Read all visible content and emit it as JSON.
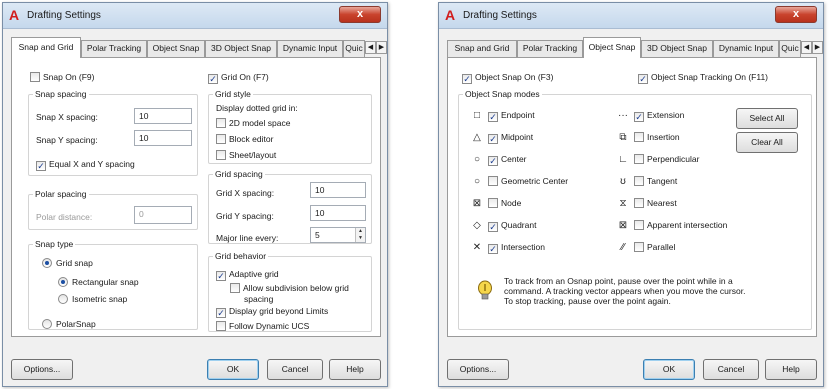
{
  "dialog1": {
    "title": "Drafting Settings",
    "close_label": "x",
    "tabs": [
      "Snap and Grid",
      "Polar Tracking",
      "Object Snap",
      "3D Object Snap",
      "Dynamic Input",
      "Quic"
    ],
    "snap_on": {
      "label": "Snap On (F9)",
      "checked": false
    },
    "grid_on": {
      "label": "Grid On (F7)",
      "checked": true
    },
    "snap_spacing": {
      "title": "Snap spacing",
      "x_label": "Snap X spacing:",
      "x_value": "10",
      "y_label": "Snap Y spacing:",
      "y_value": "10",
      "equal": {
        "label": "Equal X and Y spacing",
        "checked": true
      }
    },
    "polar_spacing": {
      "title": "Polar spacing",
      "label": "Polar distance:",
      "value": "0"
    },
    "snap_type": {
      "title": "Snap type",
      "grid_snap": "Grid snap",
      "rectangular": "Rectangular snap",
      "isometric": "Isometric snap",
      "polar": "PolarSnap"
    },
    "grid_style": {
      "title": "Grid style",
      "subtitle": "Display dotted grid in:",
      "items": [
        {
          "label": "2D model space",
          "checked": false
        },
        {
          "label": "Block editor",
          "checked": false
        },
        {
          "label": "Sheet/layout",
          "checked": false
        }
      ]
    },
    "grid_spacing": {
      "title": "Grid spacing",
      "x_label": "Grid X spacing:",
      "x_value": "10",
      "y_label": "Grid Y spacing:",
      "y_value": "10",
      "major_label": "Major line every:",
      "major_value": "5"
    },
    "grid_behavior": {
      "title": "Grid behavior",
      "adaptive": {
        "label": "Adaptive grid",
        "checked": true
      },
      "subdivision": {
        "label": "Allow subdivision below grid",
        "label2": "spacing",
        "checked": false
      },
      "beyond": {
        "label": "Display grid beyond Limits",
        "checked": true
      },
      "follow": {
        "label": "Follow Dynamic UCS",
        "checked": false
      }
    },
    "buttons": {
      "options": "Options...",
      "ok": "OK",
      "cancel": "Cancel",
      "help": "Help"
    }
  },
  "dialog2": {
    "title": "Drafting Settings",
    "close_label": "x",
    "tabs": [
      "Snap and Grid",
      "Polar Tracking",
      "Object Snap",
      "3D Object Snap",
      "Dynamic Input",
      "Quic"
    ],
    "osnap_on": {
      "label": "Object Snap On (F3)",
      "checked": true
    },
    "tracking_on": {
      "label": "Object Snap Tracking On (F11)",
      "checked": true
    },
    "modes_title": "Object Snap modes",
    "left_modes": [
      {
        "label": "Endpoint",
        "checked": true,
        "symbol": "□"
      },
      {
        "label": "Midpoint",
        "checked": true,
        "symbol": "△"
      },
      {
        "label": "Center",
        "checked": true,
        "symbol": "○"
      },
      {
        "label": "Geometric Center",
        "checked": false,
        "symbol": "○"
      },
      {
        "label": "Node",
        "checked": false,
        "symbol": "⊠"
      },
      {
        "label": "Quadrant",
        "checked": true,
        "symbol": "◇"
      },
      {
        "label": "Intersection",
        "checked": true,
        "symbol": "✕"
      }
    ],
    "right_modes": [
      {
        "label": "Extension",
        "checked": true,
        "symbol": "···"
      },
      {
        "label": "Insertion",
        "checked": false,
        "symbol": "⧉"
      },
      {
        "label": "Perpendicular",
        "checked": false,
        "symbol": "∟"
      },
      {
        "label": "Tangent",
        "checked": false,
        "symbol": "ʊ"
      },
      {
        "label": "Nearest",
        "checked": false,
        "symbol": "⧖"
      },
      {
        "label": "Apparent intersection",
        "checked": false,
        "symbol": "⊠"
      },
      {
        "label": "Parallel",
        "checked": false,
        "symbol": "∕∕"
      }
    ],
    "select_all": "Select All",
    "clear_all": "Clear All",
    "tip_lines": [
      "To track from an Osnap point, pause over the point while in a",
      "command. A tracking vector appears when you move the cursor.",
      "To stop tracking, pause over the point again."
    ],
    "buttons": {
      "options": "Options...",
      "ok": "OK",
      "cancel": "Cancel",
      "help": "Help"
    }
  }
}
